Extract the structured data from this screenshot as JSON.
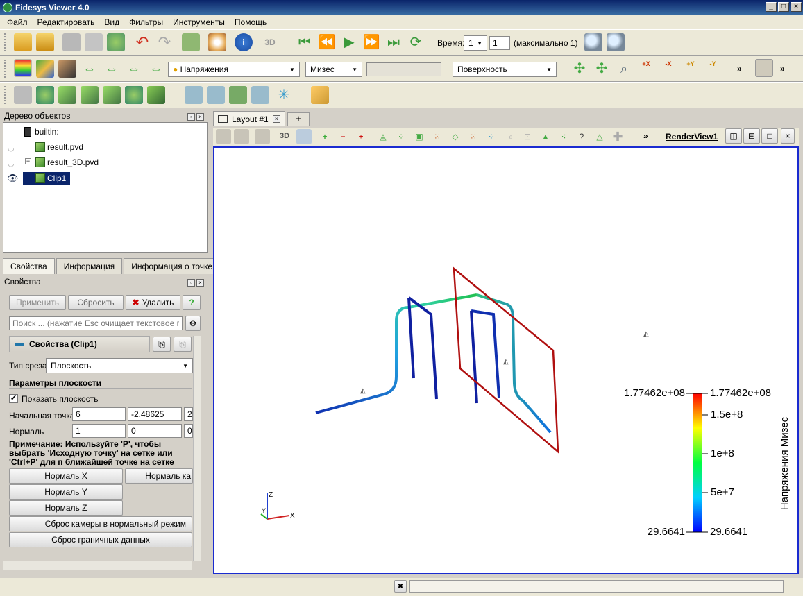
{
  "window": {
    "title": "Fidesys Viewer 4.0"
  },
  "menu": [
    "Файл",
    "Редактировать",
    "Вид",
    "Фильтры",
    "Инструменты",
    "Помощь"
  ],
  "toolbar_time": {
    "label": "Время:",
    "time_value": "1",
    "step_value": "1",
    "max_text": "(максимально 1)"
  },
  "toolbar_display": {
    "variable": "Напряжения",
    "component": "Мизес",
    "representation": "Поверхность",
    "three_d_label": "3D",
    "camera_labels": [
      "+X",
      "-X",
      "+Y",
      "-Y"
    ]
  },
  "pipeline": {
    "title": "Дерево объектов",
    "items": [
      {
        "label": "builtin:"
      },
      {
        "label": "result.pvd"
      },
      {
        "label": "result_3D.pvd"
      },
      {
        "label": "Clip1"
      }
    ]
  },
  "props_tabs": [
    "Свойства",
    "Информация",
    "Информация о точке"
  ],
  "properties": {
    "title": "Свойства",
    "apply": "Применить",
    "reset": "Сбросить",
    "delete": "Удалить",
    "help": "?",
    "search_placeholder": "Поиск ... (нажатие Esc очищает текстовое по...",
    "section_title": "Свойства (Clip1)",
    "clip_type_label": "Тип среза",
    "clip_type_value": "Плоскость",
    "plane_params": "Параметры плоскости",
    "show_plane": "Показать плоскость",
    "origin_label": "Начальная точка",
    "origin": [
      "6",
      "-2.48625",
      "2."
    ],
    "normal_label": "Нормаль",
    "normal": [
      "1",
      "0",
      "0"
    ],
    "note": "Примечание: Используйте 'P', чтобы выбрать 'Исходную точку' на сетке или 'Ctrl+P' для п ближайшей точке на сетке",
    "normal_x": "Нормаль X",
    "normal_camera": "Нормаль ка",
    "normal_y": "Нормаль Y",
    "normal_z": "Нормаль Z",
    "reset_camera": "Сброс камеры в нормальный режим",
    "reset_bounds": "Сброс граничных данных"
  },
  "layout": {
    "tab_label": "Layout #1",
    "add_tab": "+",
    "three_d": "3D",
    "render_view": "RenderView1"
  },
  "colorbar": {
    "title": "Напряжения Мизес",
    "max_label_left": "1.77462e+08",
    "max_label_right": "1.77462e+08",
    "ticks": [
      "1.5e+8",
      "1e+8",
      "5e+7"
    ],
    "min_label_left": "29.6641",
    "min_label_right": "29.6641"
  },
  "axes": {
    "x": "X",
    "y": "Y",
    "z": "Z"
  },
  "colors": {
    "accent": "#1a2bd0",
    "selection": "#0a246a",
    "plane": "#b01010"
  }
}
